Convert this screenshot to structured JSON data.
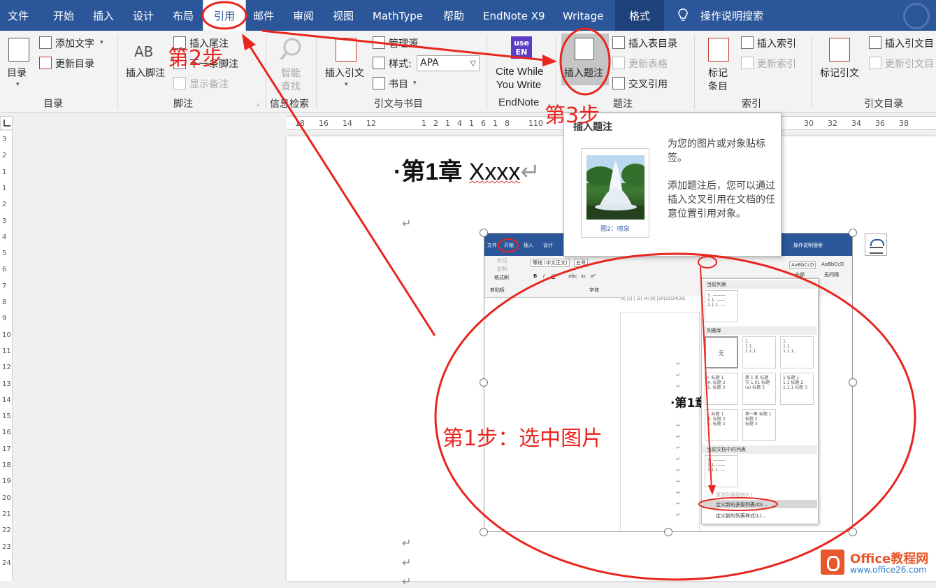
{
  "colors": {
    "ribbon_blue": "#2b579a",
    "annotation_red": "#e8251f",
    "watermark_orange": "#e8582c"
  },
  "tabs": [
    {
      "label": "文件"
    },
    {
      "label": "开始"
    },
    {
      "label": "插入"
    },
    {
      "label": "设计"
    },
    {
      "label": "布局"
    },
    {
      "label": "引用",
      "active": true
    },
    {
      "label": "邮件"
    },
    {
      "label": "审阅"
    },
    {
      "label": "视图"
    },
    {
      "label": "MathType"
    },
    {
      "label": "帮助"
    },
    {
      "label": "EndNote X9"
    },
    {
      "label": "Writage"
    },
    {
      "label": "格式"
    }
  ],
  "tell_me": {
    "icon": "lightbulb-icon",
    "label": "操作说明搜索"
  },
  "ribbon": {
    "toc": {
      "big": "目录",
      "add_text": "添加文字",
      "update": "更新目录",
      "group": "目录"
    },
    "footnotes": {
      "insert_footnote": "插入脚注",
      "insert_endnote": "插入尾注",
      "next_footnote": "下一条脚注",
      "show_notes": "显示备注",
      "group": "脚注"
    },
    "research": {
      "smart_lookup_1": "智能",
      "smart_lookup_2": "查找",
      "group": "信息检索"
    },
    "citations": {
      "insert_citation": "插入引文",
      "manage_sources": "管理源",
      "style_label": "样式:",
      "style_value": "APA",
      "bibliography": "书目",
      "group": "引文与书目"
    },
    "endnote": {
      "icon_text_1": "use",
      "icon_text_2": "EN",
      "cite_1": "Cite While",
      "cite_2": "You Write",
      "group": "EndNote"
    },
    "captions": {
      "insert_caption": "插入题注",
      "insert_tof": "插入表目录",
      "update_table": "更新表格",
      "cross_ref": "交叉引用",
      "group": "题注"
    },
    "index": {
      "mark_1": "标记",
      "mark_2": "条目",
      "insert_index": "插入索引",
      "update_index": "更新索引",
      "group": "索引"
    },
    "toa": {
      "mark_citation": "标记引文",
      "insert_toa": "插入引文目",
      "update_toa": "更新引文目",
      "group": "引文目录"
    }
  },
  "ruler": {
    "h_ticks": [
      "18",
      "16",
      "14",
      "12",
      "1",
      "2",
      "1",
      "4",
      "1",
      "6",
      "1",
      "8",
      "110",
      "30",
      "32",
      "34",
      "36",
      "38"
    ],
    "v_ticks": [
      "3",
      "2",
      "1",
      "1",
      "2",
      "3",
      "4",
      "5",
      "6",
      "7",
      "8",
      "9",
      "10",
      "11",
      "12",
      "13",
      "14",
      "15",
      "16",
      "17",
      "18",
      "19",
      "20",
      "21",
      "22",
      "23",
      "24"
    ]
  },
  "document": {
    "chapter_heading": "·第1章 ",
    "chapter_word": "Xxxx",
    "para_mark": "↵"
  },
  "tooltip": {
    "title": "插入题注",
    "image_caption": "图2：喷泉",
    "desc1": "为您的图片或对象贴标签。",
    "desc2": "添加题注后，您可以通过插入交叉引用在文档的任意位置引用对象。"
  },
  "embedded": {
    "tabs": [
      "文件",
      "开始",
      "插入",
      "设计"
    ],
    "tell_me": "操作说明搜索",
    "ribbon_items": [
      "剪切",
      "复制",
      "格式刷",
      "等线 (中文正文)",
      "五号",
      "剪贴板",
      "字体",
      "B",
      "I",
      "U",
      "abc",
      "x₂",
      "x²",
      "AaBbCcD",
      "AaBbCcD",
      "全部",
      "无间隔"
    ],
    "ruler": "|4| |2| | |2| |4| |6|     |20|22|24|26|",
    "heading": "·第1章",
    "menu": {
      "current_list": "当前列表",
      "list_library": "列表库",
      "none": "无",
      "doc_lists": "当前文档中的列表",
      "change_level": "更改列表级别(C)",
      "define_multilevel": "定义新的多级列表(D)...",
      "define_style": "定义新的列表样式(L)...",
      "box_texts": [
        "1. ———\n1.1. ——\n1.1.1. —",
        "1.\n1.1.\n1.1.1.",
        "第 1 条 标题\n节 1.01 标题\n(a) 标题 3",
        "1 标题 1\n1.1 标题 2\n1.1.1 标题 3",
        "I. 标题 1\nA. 标题 2\n1. 标题 3",
        "第一章 标题 1\n标题 2\n标题 3"
      ]
    }
  },
  "annotations": {
    "step1": "第1步：选中图片",
    "step2": "第2步",
    "step3": "第3步"
  },
  "watermark": {
    "title": "Office教程网",
    "url": "www.office26.com"
  }
}
